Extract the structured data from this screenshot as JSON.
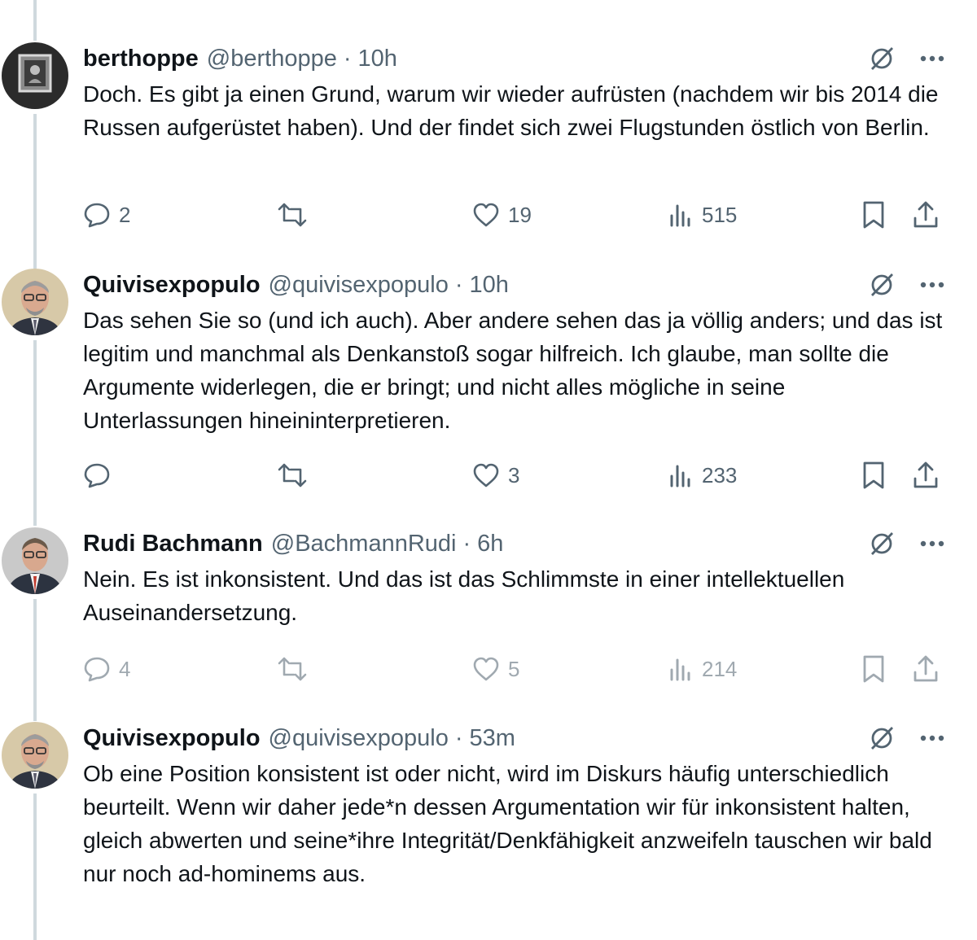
{
  "tweets": [
    {
      "name": "berthoppe",
      "handle": "@berthoppe",
      "time": "10h",
      "text": "Doch. Es gibt ja einen Grund, warum wir wieder aufrüsten (nachdem wir bis 2014 die Russen aufgerüstet haben). Und der findet sich zwei Flugstunden östlich von Berlin.",
      "replies": "2",
      "retweets": "",
      "likes": "19",
      "views": "515",
      "avatar_icon": "framed-photo-avatar"
    },
    {
      "name": "Quivisexpopulo",
      "handle": "@quivisexpopulo",
      "time": "10h",
      "text": "Das sehen Sie so (und ich auch). Aber andere sehen das ja völlig anders; und das ist legitim und manchmal als Denkanstoß sogar hilfreich. Ich glaube, man sollte die Argumente widerlegen, die er bringt; und nicht alles mögliche in seine Unterlassungen hineininterpretieren.",
      "replies": "",
      "retweets": "",
      "likes": "3",
      "views": "233",
      "avatar_icon": "man-with-glasses-avatar"
    },
    {
      "name": "Rudi Bachmann",
      "handle": "@BachmannRudi",
      "time": "6h",
      "text": "Nein. Es ist inkonsistent. Und das ist das Schlimmste in einer intellektuellen Auseinandersetzung.",
      "replies": "4",
      "retweets": "",
      "likes": "5",
      "views": "214",
      "avatar_icon": "man-in-suit-avatar"
    },
    {
      "name": "Quivisexpopulo",
      "handle": "@quivisexpopulo",
      "time": "53m",
      "text": "Ob eine Position konsistent ist oder nicht, wird im Diskurs häufig unterschiedlich beurteilt. Wenn wir daher jede*n dessen Argumentation wir für inkonsistent halten, gleich abwerten und seine*ihre Integrität/Denkfähigkeit anzweifeln tauschen wir bald nur noch ad-hominems aus.",
      "replies": "",
      "retweets": "",
      "likes": "",
      "views": "",
      "avatar_icon": "man-with-glasses-avatar"
    }
  ],
  "separator": "·",
  "colors": {
    "text": "#0f1419",
    "secondary": "#536471",
    "thread_line": "#cfd9de"
  }
}
